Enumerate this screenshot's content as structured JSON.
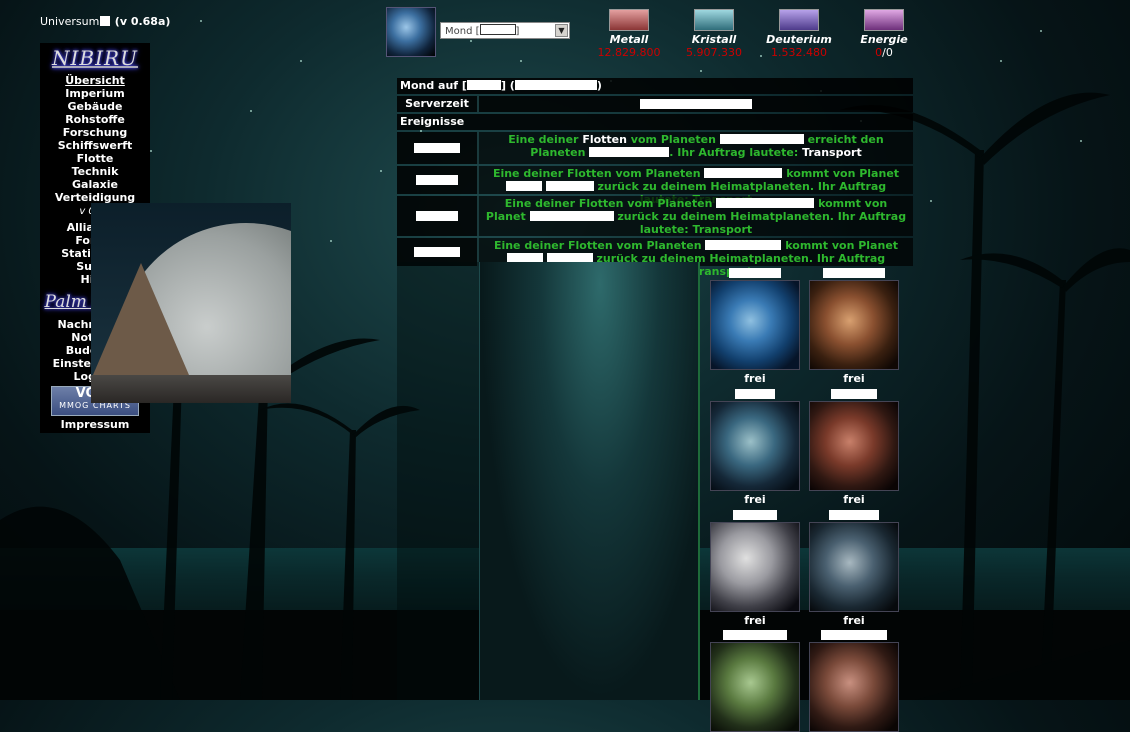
{
  "header": {
    "universe_label": "Universum",
    "version": "(v 0.68a)",
    "planet_select": "Mond ["
  },
  "resources": [
    {
      "name": "Metall",
      "value": "12.829.800",
      "color": "#c05050"
    },
    {
      "name": "Kristall",
      "value": "5.907.330",
      "color": "#3a8a9a"
    },
    {
      "name": "Deuterium",
      "value": "1.532.480",
      "color": "#7a60c0"
    },
    {
      "name": "Energie",
      "value_pos": "0",
      "value_max": "0",
      "color": "#9a50a0"
    }
  ],
  "menu": {
    "logo": "NIBIRU",
    "items1": [
      "Übersicht",
      "Imperium",
      "Gebäude",
      "Rohstoffe",
      "Forschung",
      "Schiffswerft",
      "Flotte",
      "Technik",
      "Galaxie",
      "Verteidigung"
    ],
    "version": "v 0.29",
    "items2": [
      "Allianzen",
      "Forum",
      "Statistiken",
      "Suche",
      "Hilfe"
    ],
    "sublogo": "Palm Beach",
    "items3": [
      "Nachrichten",
      "Notizen",
      "Buddylist",
      "Einstellungen",
      "Logout"
    ],
    "vote_top": "VOTE",
    "vote_bottom": "MMOG CHARTS",
    "impressum": "Impressum"
  },
  "main": {
    "title_prefix": "Mond auf [",
    "title_mid": "] (",
    "title_suffix": ")",
    "server_time_label": "Serverzeit",
    "events_label": "Ereignisse",
    "events": [
      {
        "a": "Eine deiner ",
        "b": "Flotten",
        "c": " vom Planeten ",
        "d": " erreicht den Planeten ",
        "e": ". Ihr Auftrag lautete: ",
        "f": "Transport"
      },
      {
        "a": "Eine deiner Flotten vom Planeten ",
        "b": " kommt von Planet ",
        "c": " zurück zu deinem Heimatplaneten. Ihr Auftrag lautete: Transport"
      },
      {
        "a": "Eine deiner Flotten vom Planeten ",
        "b": " kommt von Planet ",
        "c": " zurück zu deinem Heimatplaneten. Ihr Auftrag lautete: Transport"
      },
      {
        "a": "Eine deiner Flotten vom Planeten ",
        "b": " kommt von Planet ",
        "c": " zurück zu deinem Heimatplaneten. Ihr Auftrag lautete: Transport"
      }
    ],
    "slots": [
      "frei",
      "frei",
      "frei",
      "frei",
      "frei",
      "frei"
    ]
  }
}
